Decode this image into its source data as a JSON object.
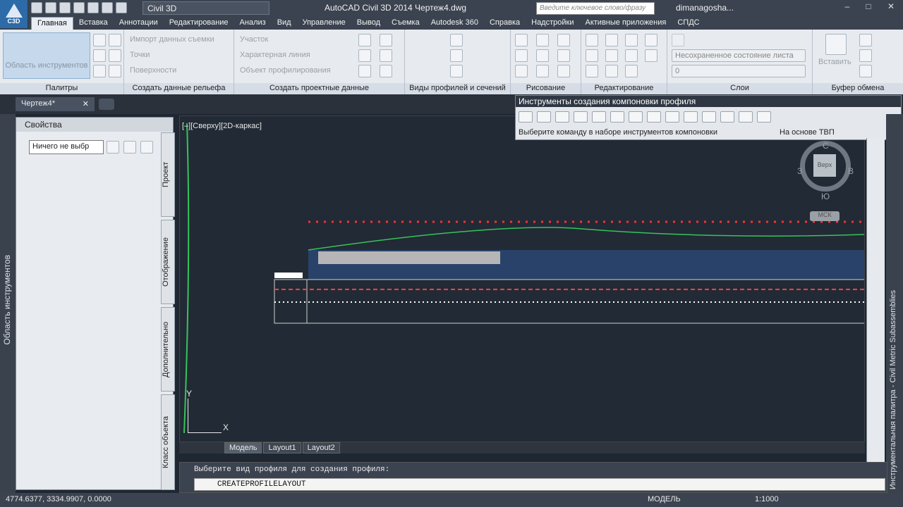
{
  "app": {
    "button_label": "C3D",
    "workspace": "Civil 3D",
    "title": "AutoCAD Civil 3D 2014    Чертеж4.dwg",
    "search_placeholder": "Введите ключевое слово/фразу",
    "username": "dimanagosha..."
  },
  "ribbon_tabs": [
    "Главная",
    "Вставка",
    "Аннотации",
    "Редактирование",
    "Анализ",
    "Вид",
    "Управление",
    "Вывод",
    "Съемка",
    "Autodesk 360",
    "Справка",
    "Надстройки",
    "Активные приложения",
    "СПДС"
  ],
  "ribbon": {
    "tool_area": "Область инструментов",
    "palettes": "Палитры",
    "terrain": {
      "label": "Создать данные рельефа",
      "items": [
        "Импорт данных съемки",
        "Точки",
        "Поверхности"
      ]
    },
    "design": {
      "label": "Создать проектные данные",
      "items": [
        "Участок",
        "Характерная линия",
        "Объект профилирования"
      ]
    },
    "profiles": "Виды профилей и сечений",
    "draw": "Рисование",
    "edit": "Редактирование",
    "layers": {
      "label": "Слои",
      "state": "Несохраненное состояние листа",
      "layer": "0"
    },
    "paste": "Вставить",
    "clipboard": "Буфер обмена"
  },
  "doc_tab": "Чертеж4*",
  "properties": {
    "title": "Свойства",
    "select": "Ничего не выбр",
    "tabs": [
      "Проект",
      "Отображение",
      "Дополнительно",
      "Класс объекта"
    ]
  },
  "left_panel_label": "Область инструментов",
  "viewport_label": "[–][Сверху][2D-каркас]",
  "float_toolbar": {
    "title": "Инструменты создания компоновки профиля",
    "prompt": "Выберите команду в наборе инструментов компоновки",
    "mode": "На основе ТВП"
  },
  "navcube": {
    "n": "С",
    "s": "Ю",
    "w": "З",
    "e": "В",
    "top": "Верх",
    "ucs": "МСК"
  },
  "layout_tabs": [
    "Модель",
    "Layout1",
    "Layout2"
  ],
  "command": {
    "history": "Выберите вид профиля для создания профиля:",
    "current": "CREATEPROFILELAYOUT"
  },
  "right_palette": "Инструментальная палитра - Civil Metric Subassemblies",
  "status": {
    "coords": "4774.6377, 3334.9907, 0.0000",
    "model": "МОДЕЛЬ",
    "scale": "1:1000"
  }
}
